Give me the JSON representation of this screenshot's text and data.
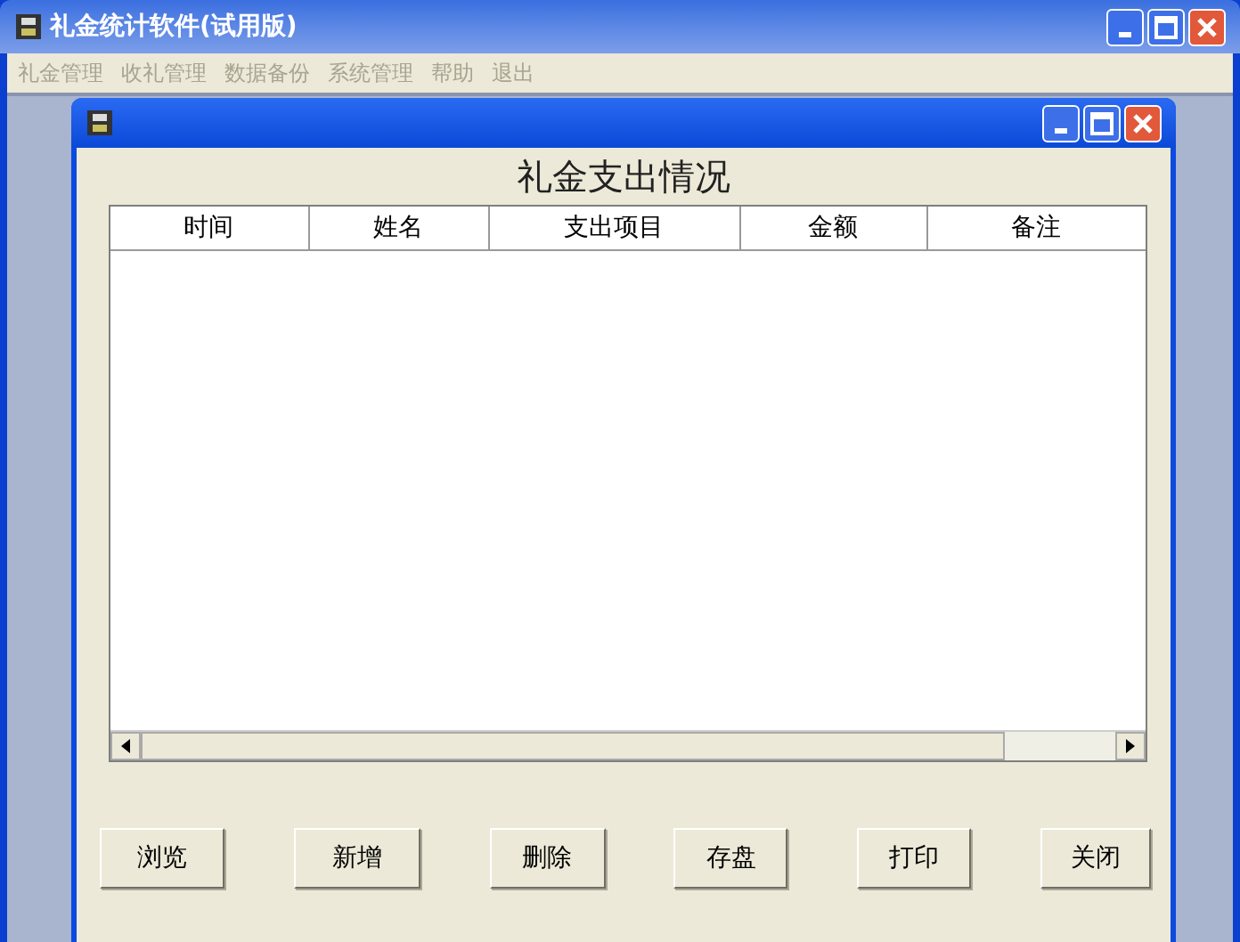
{
  "window": {
    "title": "礼金统计软件(试用版)"
  },
  "menu": [
    {
      "label": "礼金管理",
      "disabled": true
    },
    {
      "label": "收礼管理",
      "disabled": true
    },
    {
      "label": "数据备份",
      "disabled": true
    },
    {
      "label": "系统管理",
      "disabled": true
    },
    {
      "label": "帮助",
      "disabled": true
    },
    {
      "label": "退出",
      "disabled": true
    }
  ],
  "child_window": {
    "heading": "礼金支出情况",
    "table": {
      "columns": [
        "时间",
        "姓名",
        "支出项目",
        "金额",
        "备注"
      ]
    },
    "buttons": [
      "浏览",
      "新增",
      "删除",
      "存盘",
      "打印",
      "关闭"
    ]
  }
}
